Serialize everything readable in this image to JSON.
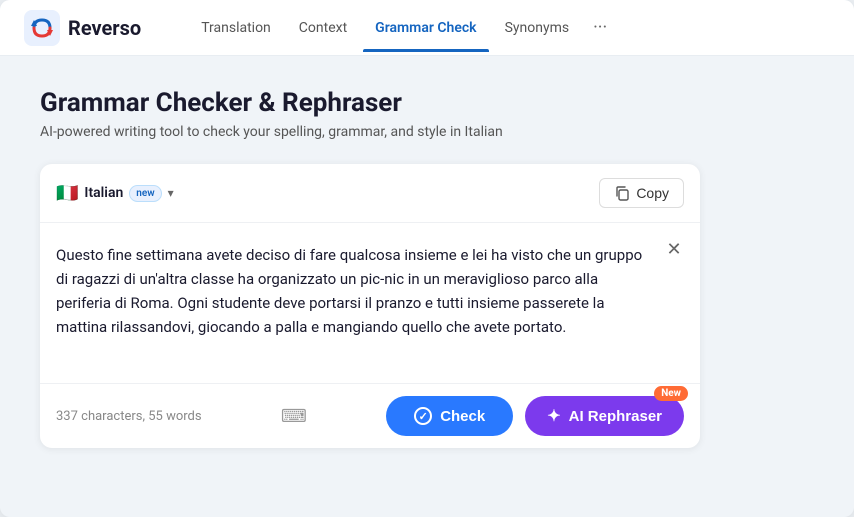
{
  "navbar": {
    "logo_text": "Reverso",
    "nav_items": [
      {
        "label": "Translation",
        "active": false
      },
      {
        "label": "Context",
        "active": false
      },
      {
        "label": "Grammar Check",
        "active": true
      },
      {
        "label": "Synonyms",
        "active": false
      }
    ],
    "more_icon": "···"
  },
  "page": {
    "title": "Grammar Checker & Rephraser",
    "subtitle": "AI-powered writing tool to check your spelling, grammar, and style in Italian"
  },
  "card": {
    "language": {
      "flag": "🇮🇹",
      "name": "Italian",
      "badge": "new"
    },
    "copy_label": "Copy",
    "close_icon": "✕",
    "text_content": "Questo fine settimana avete deciso di fare qualcosa insieme e lei ha visto che un gruppo di ragazzi di un'altra classe ha organizzato un pic-nic in un meraviglioso parco alla periferia di Roma. Ogni studente deve portarsi il pranzo e tutti insieme passerete la mattina rilassandovi, giocando a palla e mangiando quello che avete portato.",
    "char_count": "337 characters,  55 words",
    "check_label": "Check",
    "rephraser_label": "AI Rephraser",
    "rephraser_new_badge": "New"
  }
}
